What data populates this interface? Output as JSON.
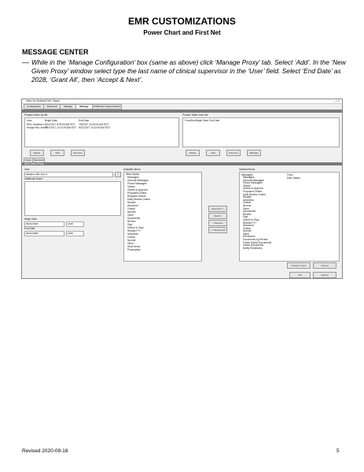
{
  "document": {
    "title": "EMR CUSTOMIZATIONS",
    "subtitle": "Power Chart and First Net",
    "section_heading": "MESSAGE CENTER",
    "instruction_dash": "—",
    "instruction": "While in the ‘Manage Configuration’ box (same as above) click ‘Manage Proxy’ tab. Select ‘Add’. In the ‘New Given Proxy’ window select type the last name of clinical supervisor in the ‘User’ field. Select ‘End Date’ as 2028, ‘Grant All’, then ‘Accept & Next’.",
    "footer_revised": "Revised 2020-09-18",
    "page_number": "5"
  },
  "screenshot": {
    "window_title": "Inbox for Modesto Pelt, Susan",
    "tabs": [
      "Configuration",
      "Advanced Pools",
      "Manage Pools",
      "Manage Proxy",
      "PV/Result Customizations"
    ],
    "active_tab": 3,
    "proxies_given_label": "Proxies Given by Me",
    "given_columns": [
      "User",
      "Begin Date",
      "End Date"
    ],
    "given_rows": [
      [
        "Rich, Modesto L",
        "8/31/2017 8:29:00 AM EDT",
        "7/6/2027 10:15:00 AM EDT"
      ],
      [
        "Hodge-Kirk, Ann R",
        "9/21/2017 10:13:00 AM EDT",
        "9/21/2027 10:13:00 AM EDT"
      ]
    ],
    "given_buttons": [
      "Delete",
      "Add",
      "Remove"
    ],
    "proxies_taken_label": "Proxies Taken from Me",
    "taken_columns": [
      "From",
      "Give",
      "Begin Date",
      "End Date"
    ],
    "taken_buttons": [
      "Delete",
      "Add",
      "Remove",
      "Manage"
    ],
    "subtabs": [
      "Given",
      "Received"
    ],
    "new_proxy_label": "New Given Proxy",
    "user_label": "User",
    "user_value": "Madigan MD, Dan K",
    "additional_users_label": "Additional Users",
    "begin_date_label": "Begin Date",
    "begin_date_value": "09/21/2018",
    "begin_time_value": "1408",
    "end_date_label": "End Date",
    "end_date_value": "09/21/2028",
    "end_time_value": "1408",
    "available_items_label": "Available Items",
    "available_header": "Items Name",
    "available_items": [
      "Messages",
      "General Messages",
      "Phone Messages",
      "Orders",
      "Orders to Approve",
      "Proposed Orders",
      "Required Orders",
      "Daily Review Orders",
      "Results",
      "Abnormal",
      "Critical",
      "Normal",
      "Other",
      "Documents",
      "Review",
      "Sign",
      "Orders to Sign",
      "Results FYI",
      "Abnormal",
      "Critical",
      "Normal",
      "Other",
      "Work Items",
      "Prescription"
    ],
    "move_buttons": [
      "Grant All >>",
      "Grant >",
      "< Revoke",
      "<< Revoke All"
    ],
    "granted_items_label": "Granted Items",
    "granted_columns": [
      "Messages",
      "From",
      "Date Stamp"
    ],
    "granted_items": [
      "Messages",
      "General Messages",
      "Phone Messages",
      "Orders",
      "Orders to Approve",
      "Proposed Orders",
      "Daily Review Orders",
      "Results",
      "Abnormal",
      "Critical",
      "Normal",
      "Other",
      "Documents",
      "Review",
      "Sign",
      "Orders to Sign",
      "Results FYI",
      "Abnormal",
      "Critical",
      "Normal",
      "Other",
      "Reminders",
      "Documents by Review",
      "Future Saved Documents",
      "Saved Documents",
      "Notify Reminders"
    ],
    "accept_button": "Accept & Next",
    "cancel_button": "Cancel",
    "ok_button": "OK",
    "bottom_cancel_button": "Cancel"
  }
}
